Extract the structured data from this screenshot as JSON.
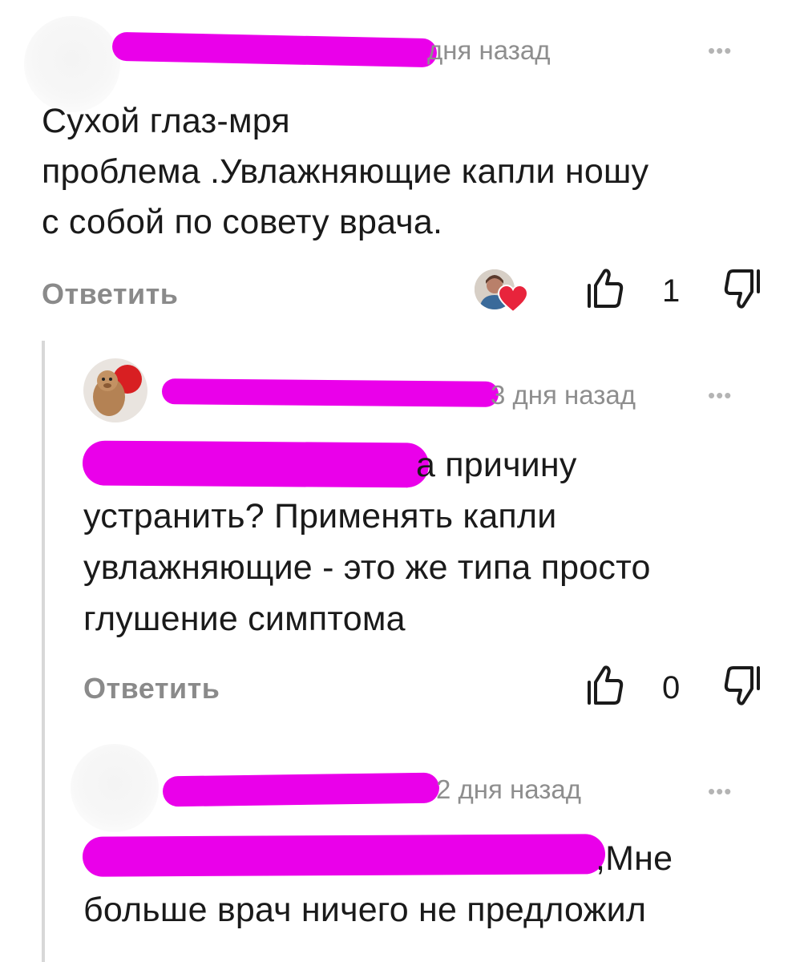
{
  "comment1": {
    "time_tail": "дня назад",
    "more": "•••",
    "text_lines": [
      "Сухой глаз-мря",
      "проблема .Увлажняющие капли ношу",
      "с собой по совету врача."
    ],
    "reply_label": "Ответить",
    "like_count": "1"
  },
  "comment2": {
    "time_tail": "3 дня назад",
    "more": "•••",
    "text_line1_tail": "а причину",
    "text_lines": [
      "устранить? Применять капли",
      "увлажняющие - это же типа просто",
      "глушение симптома"
    ],
    "reply_label": "Ответить",
    "like_count": "0"
  },
  "comment3": {
    "time_tail": "2 дня назад",
    "more": "•••",
    "text_line1_tail": ",Мне",
    "text_lines": [
      "больше врач ничего не предложил"
    ]
  },
  "colors": {
    "redaction": "#ea00ea",
    "heart": "#e8243c",
    "muted_text": "#8e8e8e"
  },
  "icons": [
    "thumbs-up-icon",
    "thumbs-down-icon",
    "heart-icon",
    "more-dots-icon"
  ]
}
